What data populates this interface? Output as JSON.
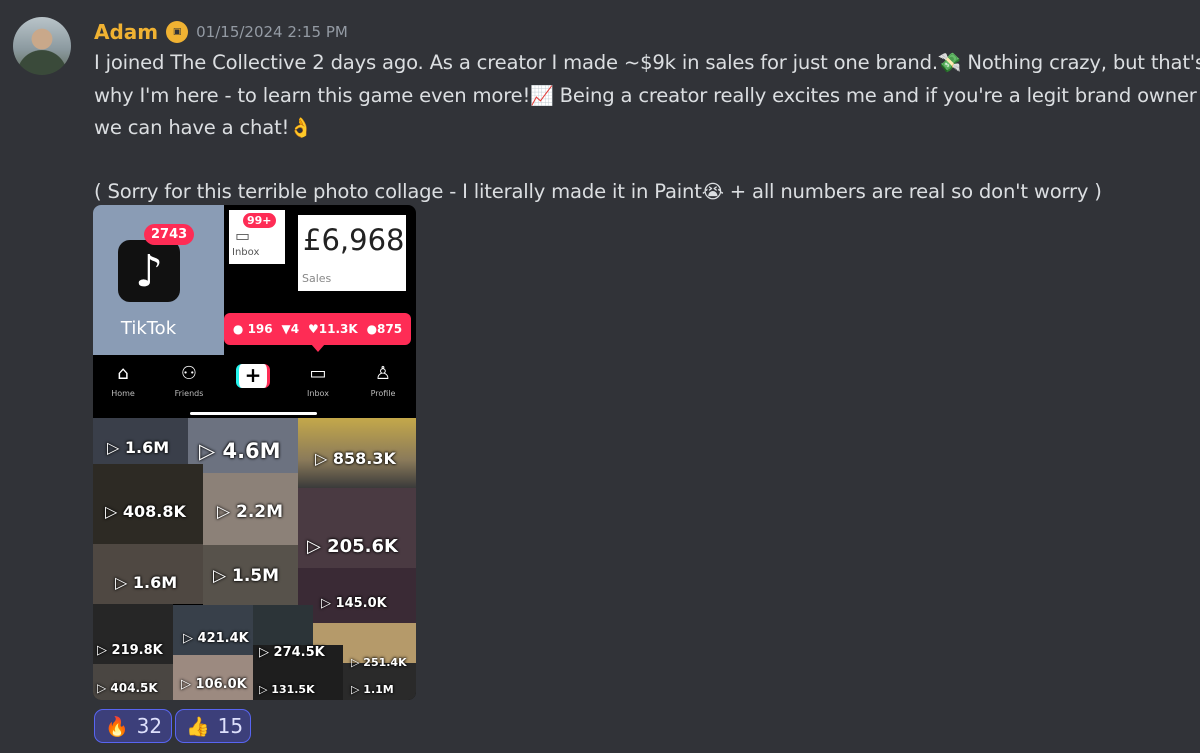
{
  "message": {
    "author": "Adam",
    "badge_icon": "guild-badge-icon",
    "timestamp": "01/15/2024 2:15 PM",
    "line1": "I joined The Collective 2 days ago. As a creator I made ~$9k in sales for just one brand.",
    "line1_emoji": "💸",
    "line1_tail": " Nothing crazy, but that's",
    "line2": "why I'm here - to learn this game even more!",
    "line2_emoji": "📈",
    "line2_tail": " Being a creator really excites me and if you're a legit brand owner",
    "line3": "we can have a chat!",
    "line3_emoji": "👌",
    "line4": "( Sorry for this terrible photo collage - I literally made it in Paint",
    "line4_emoji": "😭",
    "line4_tail": " + all numbers are real so don't worry )"
  },
  "collage": {
    "tiktok_count": "2743",
    "tiktok_name": "TikTok",
    "inbox_badge": "99+",
    "inbox_label": "Inbox",
    "sales_value": "£6,968",
    "sales_label": "Sales",
    "stats": {
      "comments": "196",
      "reposts": "4",
      "likes": "11.3K",
      "followers": "875"
    },
    "nav": {
      "home": "Home",
      "friends": "Friends",
      "plus": "+",
      "inbox": "Inbox",
      "profile": "Profile"
    },
    "views": [
      "▷ 1.6M",
      "▷ 4.6M",
      "▷ 858.3K",
      "▷ 408.8K",
      "▷ 2.2M",
      "▷ 205.6K",
      "▷ 1.6M",
      "▷ 1.5M",
      "▷ 145.0K",
      "▷ 219.8K",
      "▷ 421.4K",
      "▷ 274.5K",
      "▷ 251.4K",
      "▷ 404.5K",
      "▷ 106.0K",
      "▷ 131.5K",
      "▷ 1.1M"
    ]
  },
  "reactions": [
    {
      "emoji": "🔥",
      "count": "32"
    },
    {
      "emoji": "👍",
      "count": "15"
    }
  ]
}
